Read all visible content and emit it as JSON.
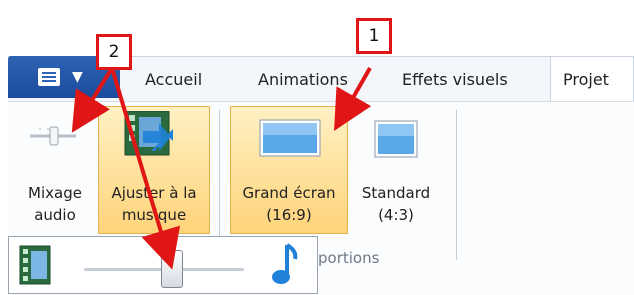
{
  "tabs": [
    {
      "label": "Accueil"
    },
    {
      "label": "Animations"
    },
    {
      "label": "Effets visuels"
    },
    {
      "label": "Projet"
    }
  ],
  "ribbon": {
    "mixage": {
      "label_line1": "Mixage",
      "label_line2": "audio"
    },
    "ajuster": {
      "label_line1": "Ajuster à la",
      "label_line2": "musique"
    },
    "grand": {
      "label_line1": "Grand écran",
      "label_line2": "(16:9)"
    },
    "standard": {
      "label_line1": "Standard",
      "label_line2": "(4:3)"
    },
    "group_label": "portions"
  },
  "callouts": {
    "one": "1",
    "two": "2"
  },
  "popup": {
    "slider_value": 0.55
  },
  "colors": {
    "annotation_red": "#e01515",
    "selected_orange": "#ffd37a",
    "app_menu_blue": "#1b4b9c",
    "music_note_blue": "#1f82d8"
  }
}
